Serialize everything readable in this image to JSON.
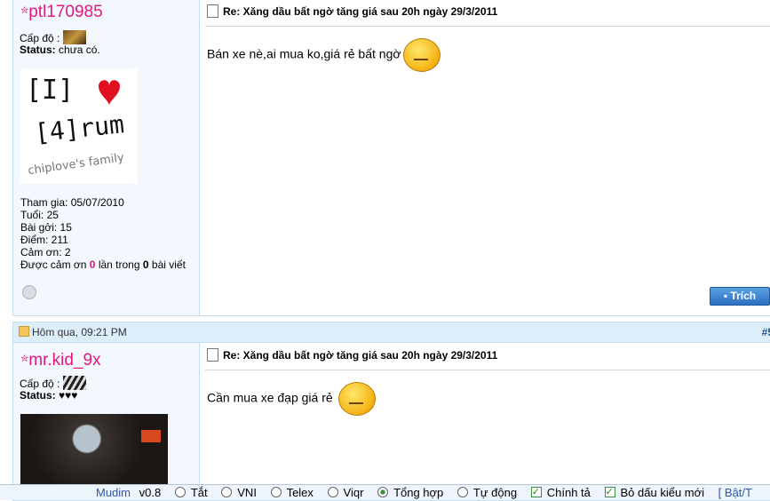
{
  "post1": {
    "username": "ptl170985",
    "level_label": "Cấp độ :",
    "status_label": "Status:",
    "status_value": "chưa có.",
    "avatar": {
      "line1": "[I]",
      "line2": "[4]rum",
      "line3": "chiplove's family"
    },
    "stats": {
      "joined": "Tham gia: 05/07/2010",
      "age": "Tuổi: 25",
      "posts": "Bài gởi: 15",
      "points": "Điểm: 211",
      "thanks": "Cảm ơn: 2",
      "thanked_prefix": "Được cảm ơn",
      "thanked_count": "0",
      "thanked_mid": "lần trong",
      "thanked_posts": "0",
      "thanked_suffix": "bài viết"
    },
    "title": "Re: Xăng dầu bất ngờ tăng giá sau 20h ngày 29/3/2011",
    "message": "Bán xe nè,ai mua ko,giá rẻ bất ngờ",
    "quote_button": "Trích"
  },
  "post2": {
    "date": "Hôm qua, 09:21 PM",
    "post_number": "#5",
    "username": "mr.kid_9x",
    "level_label": "Cấp độ :",
    "status_label": "Status:",
    "status_value": "♥♥♥",
    "title": "Re: Xăng dầu bất ngờ tăng giá sau 20h ngày 29/3/2011",
    "message": "Cần mua xe đạp giá rẻ"
  },
  "statusbar": {
    "app": "Mudim",
    "version": "v0.8",
    "off": "Tắt",
    "vni": "VNI",
    "telex": "Telex",
    "viqr": "Viqr",
    "combined": "Tổng hợp",
    "auto": "Tự động",
    "spell": "Chính tả",
    "new_accent": "Bỏ dấu kiểu mới",
    "toggle": "[ Bật/T"
  }
}
